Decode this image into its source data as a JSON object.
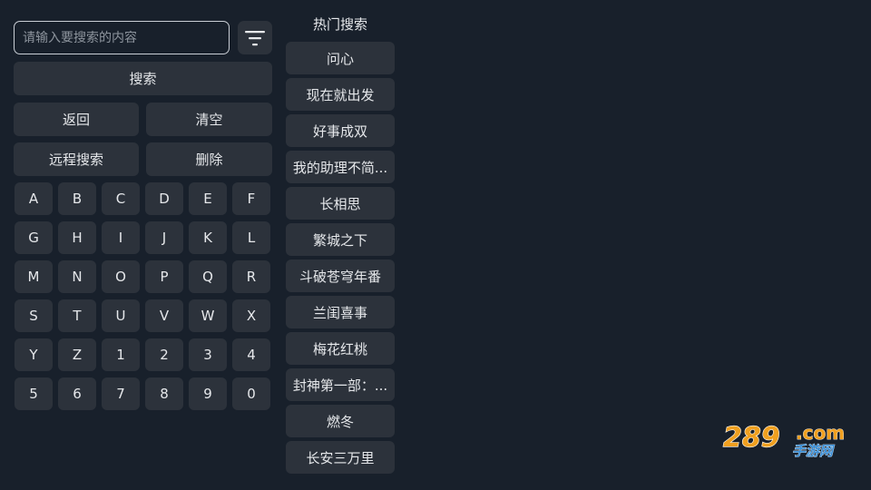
{
  "search": {
    "placeholder": "请输入要搜索的内容",
    "value": ""
  },
  "actions": {
    "search_label": "搜索",
    "back_label": "返回",
    "clear_label": "清空",
    "remote_label": "远程搜索",
    "delete_label": "删除"
  },
  "keyboard": {
    "keys": [
      "A",
      "B",
      "C",
      "D",
      "E",
      "F",
      "G",
      "H",
      "I",
      "J",
      "K",
      "L",
      "M",
      "N",
      "O",
      "P",
      "Q",
      "R",
      "S",
      "T",
      "U",
      "V",
      "W",
      "X",
      "Y",
      "Z",
      "1",
      "2",
      "3",
      "4",
      "5",
      "6",
      "7",
      "8",
      "9",
      "0"
    ]
  },
  "hot": {
    "title": "热门搜索",
    "items": [
      "问心",
      "现在就出发",
      "好事成双",
      "我的助理不简...",
      "长相思",
      "繁城之下",
      "斗破苍穹年番",
      "兰闺喜事",
      "梅花红桃",
      "封神第一部：...",
      "燃冬",
      "长安三万里"
    ]
  },
  "watermark": {
    "number": "289",
    "domain": ".com",
    "cn": "手游网"
  },
  "colors": {
    "background": "#18202b",
    "button": "#2c323b",
    "text": "#e6e8eb",
    "watermark_orange": "#f0a020",
    "watermark_blue": "#3a8ed6"
  },
  "icons": {
    "filter": "filter-icon"
  }
}
